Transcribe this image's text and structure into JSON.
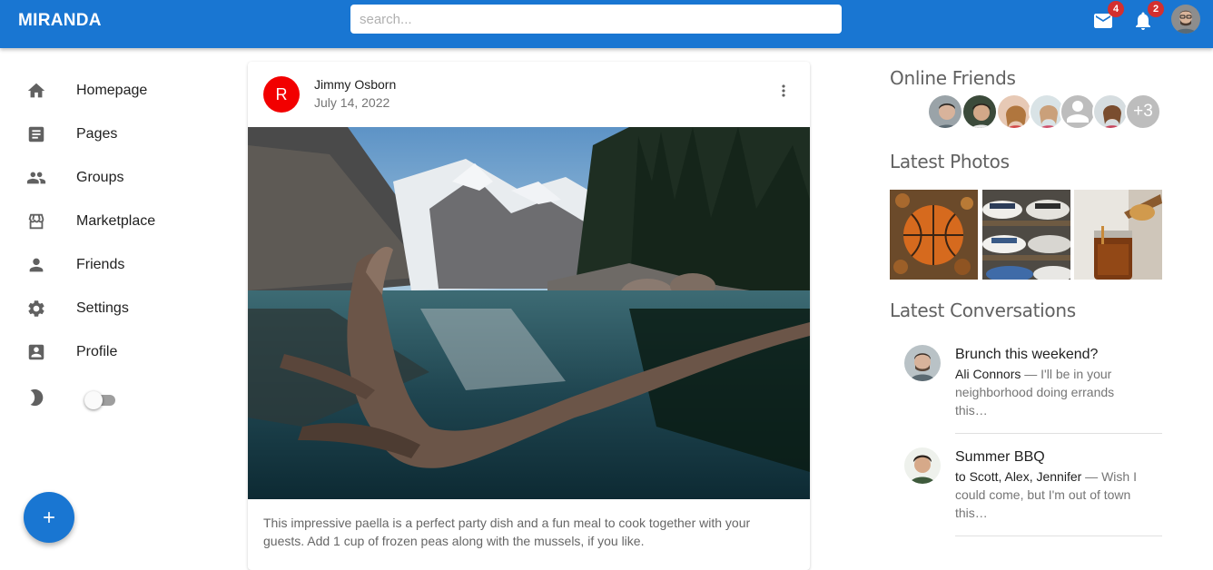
{
  "app": {
    "brand": "MIRANDA"
  },
  "search": {
    "placeholder": "search..."
  },
  "header": {
    "mail_icon": "mail-icon",
    "mail_badge": "4",
    "notifications_icon": "bell-icon",
    "notifications_badge": "2",
    "brand_color": "#1976d2"
  },
  "sidebar": {
    "items": [
      {
        "label": "Homepage",
        "icon": "home-icon"
      },
      {
        "label": "Pages",
        "icon": "article-icon"
      },
      {
        "label": "Groups",
        "icon": "group-icon"
      },
      {
        "label": "Marketplace",
        "icon": "storefront-icon"
      },
      {
        "label": "Friends",
        "icon": "person-icon"
      },
      {
        "label": "Settings",
        "icon": "gear-icon"
      },
      {
        "label": "Profile",
        "icon": "account-box-icon"
      }
    ],
    "dark_mode_icon": "moon-icon",
    "dark_mode_enabled": false
  },
  "fab": {
    "icon": "plus-icon"
  },
  "post": {
    "avatar_letter": "R",
    "avatar_color": "#f20000",
    "author": "Jimmy Osborn",
    "date": "July 14, 2022",
    "menu_icon": "more-vert-icon",
    "text": "This impressive paella is a perfect party dish and a fun meal to cook together with your guests. Add 1 cup of frozen peas along with the mussels, if you like."
  },
  "right": {
    "online_friends_title": "Online Friends",
    "online_more": "+3",
    "latest_photos_title": "Latest Photos",
    "latest_conversations_title": "Latest Conversations",
    "conversations": [
      {
        "title": "Brunch this weekend?",
        "from": "Ali Connors",
        "snippet": " — I'll be in your neighborhood doing errands this…"
      },
      {
        "title": "Summer BBQ",
        "from": "to Scott, Alex, Jennifer",
        "snippet": " — Wish I could come, but I'm out of town this…"
      }
    ]
  }
}
